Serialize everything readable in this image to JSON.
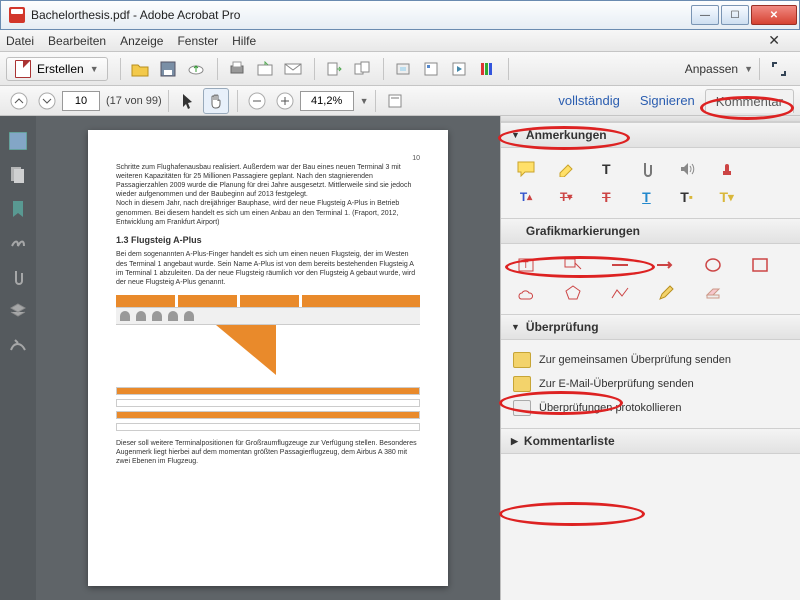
{
  "window": {
    "title": "Bachelorthesis.pdf - Adobe Acrobat Pro"
  },
  "menu": {
    "file": "Datei",
    "edit": "Bearbeiten",
    "view": "Anzeige",
    "window": "Fenster",
    "help": "Hilfe"
  },
  "toolbar": {
    "create": "Erstellen",
    "customize": "Anpassen"
  },
  "nav": {
    "page_value": "10",
    "page_total": "(17 von 99)",
    "zoom_value": "41,2%"
  },
  "right_tabs": {
    "fullscreen": "vollständig",
    "sign": "Signieren",
    "comment": "Kommentar"
  },
  "doc": {
    "page_number": "10",
    "p1": "Schritte zum Flughafenausbau realisiert. Außerdem war der Bau eines neuen Terminal 3 mit weiteren Kapazitäten für 25 Millionen Passagiere geplant. Nach den stagnierenden Passagierzahlen 2009 wurde die Planung für drei Jahre ausgesetzt. Mittlerweile sind sie jedoch wieder aufgenommen und der Baubeginn auf 2013 festgelegt.",
    "p2": "Noch in diesem Jahr, nach dreijähriger Bauphase, wird der neue Flugsteig A-Plus in Betrieb genommen. Bei diesem handelt es sich um einen Anbau an den Terminal 1. (Fraport, 2012, Entwicklung am Frankfurt Airport)",
    "h1": "1.3 Flugsteig A-Plus",
    "p3": "Bei dem sogenannten A-Plus-Finger handelt es sich um einen neuen Flugsteig, der im Westen des Terminal 1 angebaut wurde. Sein Name A-Plus ist von dem bereits bestehenden Flugsteig A im Terminal 1 abzuleiten. Da der neue Flugsteig räumlich vor den Flugsteig A gebaut wurde, wird der neue Flugsteig A-Plus genannt.",
    "p4": "Dieser soll weitere Terminalpositionen für Großraumflugzeuge zur Verfügung stellen. Besonderes Augenmerk liegt hierbei auf dem momentan größten Passagierflugzeug, dem Airbus A 380 mit zwei Ebenen im Flugzeug."
  },
  "panels": {
    "annotations": "Anmerkungen",
    "drawing": "Grafikmarkierungen",
    "review": "Überprüfung",
    "review_items": {
      "shared": "Zur gemeinsamen Überprüfung senden",
      "email": "Zur E-Mail-Überprüfung senden",
      "track": "Überprüfungen protokollieren"
    },
    "comment_list": "Kommentarliste"
  }
}
